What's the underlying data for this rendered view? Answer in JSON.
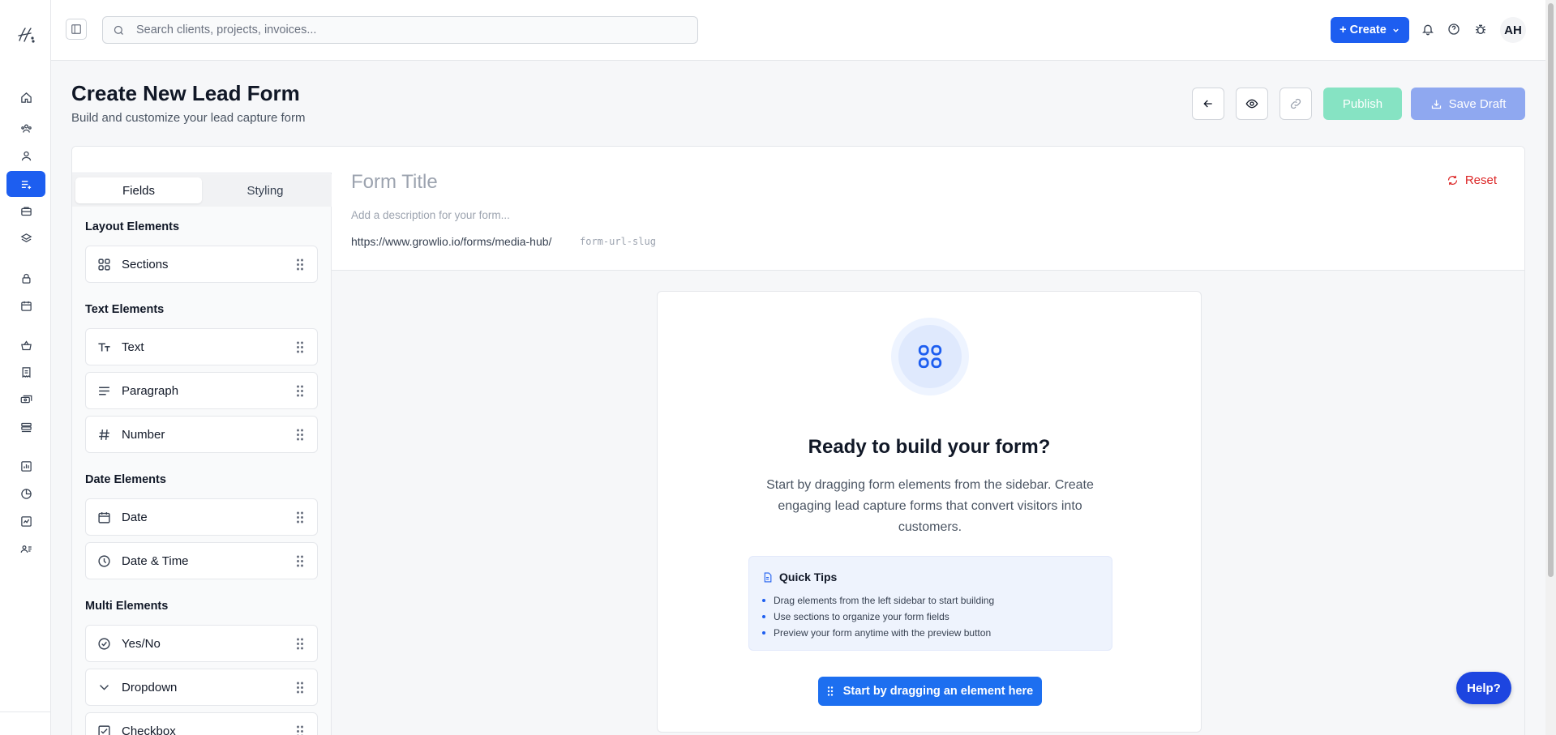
{
  "topbar": {
    "search_placeholder": "Search clients, projects, invoices...",
    "create_label": "+ Create",
    "avatar_initials": "AH"
  },
  "page": {
    "title": "Create New Lead Form",
    "subtitle": "Build and customize your lead capture form",
    "publish_label": "Publish",
    "save_draft_label": "Save Draft"
  },
  "sidebar": {
    "tabs": [
      {
        "label": "Fields",
        "active": true
      },
      {
        "label": "Styling",
        "active": false
      }
    ],
    "groups": [
      {
        "title": "Layout Elements",
        "items": [
          {
            "label": "Sections",
            "icon": "grid-icon"
          }
        ]
      },
      {
        "title": "Text Elements",
        "items": [
          {
            "label": "Text",
            "icon": "text-type-icon"
          },
          {
            "label": "Paragraph",
            "icon": "paragraph-icon"
          },
          {
            "label": "Number",
            "icon": "hash-icon"
          }
        ]
      },
      {
        "title": "Date Elements",
        "items": [
          {
            "label": "Date",
            "icon": "calendar-icon"
          },
          {
            "label": "Date & Time",
            "icon": "clock-icon"
          }
        ]
      },
      {
        "title": "Multi Elements",
        "items": [
          {
            "label": "Yes/No",
            "icon": "check-circle-icon"
          },
          {
            "label": "Dropdown",
            "icon": "chevron-down-icon"
          },
          {
            "label": "Checkbox",
            "icon": "checkbox-icon"
          }
        ]
      }
    ]
  },
  "form": {
    "title_placeholder": "Form Title",
    "description_placeholder": "Add a description for your form...",
    "url_base": "https://www.growlio.io/forms/media-hub/",
    "url_slug_placeholder": "form-url-slug",
    "reset_label": "Reset"
  },
  "empty_state": {
    "heading": "Ready to build your form?",
    "text": "Start by dragging form elements from the sidebar. Create engaging lead capture forms that convert visitors into customers.",
    "tips_title": "Quick Tips",
    "tips": [
      "Drag elements from the left sidebar to start building",
      "Use sections to organize your form fields",
      "Preview your form anytime with the preview button"
    ],
    "start_label": "Start by dragging an element here"
  },
  "help_label": "Help?",
  "colors": {
    "accent": "#1d5ef0",
    "publish_disabled": "#86e3c3",
    "save_disabled": "#8fa8f0",
    "reset": "#dc2626"
  }
}
